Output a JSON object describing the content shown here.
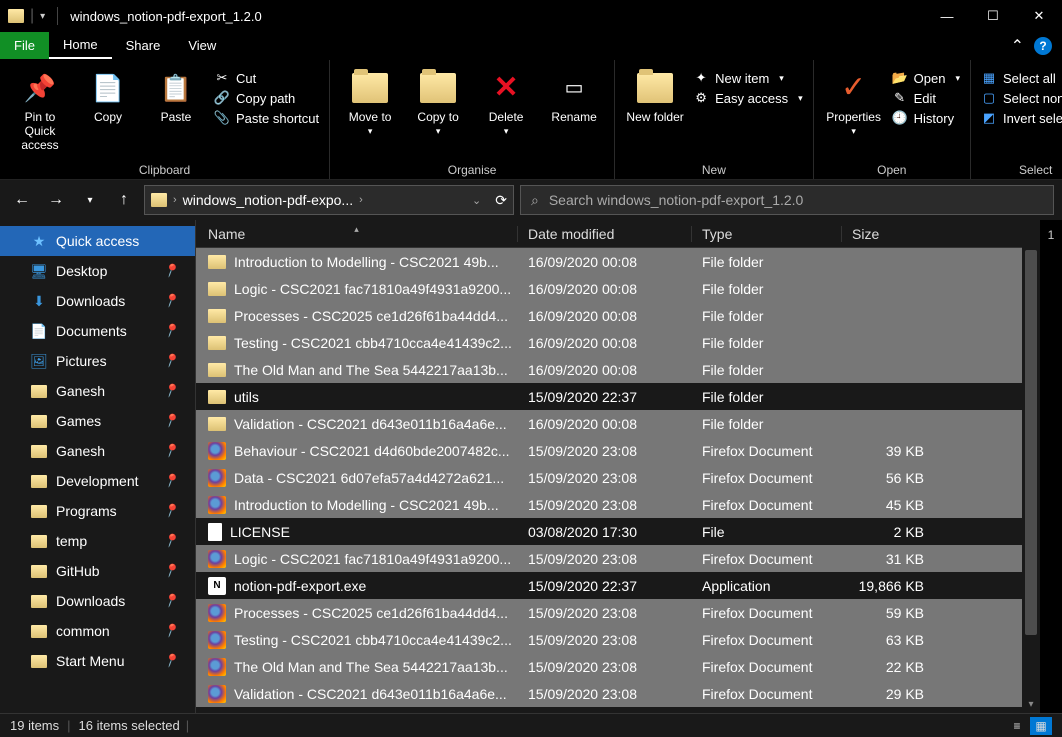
{
  "title": "windows_notion-pdf-export_1.2.0",
  "ribbon_tabs": {
    "file": "File",
    "home": "Home",
    "share": "Share",
    "view": "View"
  },
  "ribbon": {
    "pin": "Pin to Quick access",
    "copy": "Copy",
    "paste": "Paste",
    "cut": "Cut",
    "copy_path": "Copy path",
    "paste_shortcut": "Paste shortcut",
    "clipboard_label": "Clipboard",
    "move_to": "Move to",
    "copy_to": "Copy to",
    "delete": "Delete",
    "rename": "Rename",
    "organise_label": "Organise",
    "new_folder": "New folder",
    "new_item": "New item",
    "easy_access": "Easy access",
    "new_label": "New",
    "properties": "Properties",
    "open": "Open",
    "edit": "Edit",
    "history": "History",
    "open_label": "Open",
    "select_all": "Select all",
    "select_none": "Select none",
    "invert_selection": "Invert selection",
    "select_label": "Select"
  },
  "address": {
    "crumb": "windows_notion-pdf-expo..."
  },
  "search": {
    "placeholder": "Search windows_notion-pdf-export_1.2.0"
  },
  "sidebar": {
    "quick_access": "Quick access",
    "items": [
      {
        "label": "Desktop",
        "icon": "desktop"
      },
      {
        "label": "Downloads",
        "icon": "download"
      },
      {
        "label": "Documents",
        "icon": "doc"
      },
      {
        "label": "Pictures",
        "icon": "pic"
      },
      {
        "label": "Ganesh",
        "icon": "folder"
      },
      {
        "label": "Games",
        "icon": "folder"
      },
      {
        "label": "Ganesh",
        "icon": "folder"
      },
      {
        "label": "Development",
        "icon": "folder"
      },
      {
        "label": "Programs",
        "icon": "folder"
      },
      {
        "label": "temp",
        "icon": "folder"
      },
      {
        "label": "GitHub",
        "icon": "folder"
      },
      {
        "label": "Downloads",
        "icon": "folder"
      },
      {
        "label": "common",
        "icon": "folder"
      },
      {
        "label": "Start Menu",
        "icon": "folder"
      }
    ]
  },
  "columns": {
    "name": "Name",
    "date": "Date modified",
    "type": "Type",
    "size": "Size"
  },
  "files": [
    {
      "sel": true,
      "icon": "folder",
      "name": "Introduction to Modelling - CSC2021 49b...",
      "date": "16/09/2020 00:08",
      "type": "File folder",
      "size": ""
    },
    {
      "sel": true,
      "icon": "folder",
      "name": "Logic - CSC2021 fac71810a49f4931a9200...",
      "date": "16/09/2020 00:08",
      "type": "File folder",
      "size": ""
    },
    {
      "sel": true,
      "icon": "folder",
      "name": "Processes - CSC2025 ce1d26f61ba44dd4...",
      "date": "16/09/2020 00:08",
      "type": "File folder",
      "size": ""
    },
    {
      "sel": true,
      "icon": "folder",
      "name": "Testing - CSC2021 cbb4710cca4e41439c2...",
      "date": "16/09/2020 00:08",
      "type": "File folder",
      "size": ""
    },
    {
      "sel": true,
      "icon": "folder",
      "name": "The Old Man and The Sea 5442217aa13b...",
      "date": "16/09/2020 00:08",
      "type": "File folder",
      "size": ""
    },
    {
      "sel": false,
      "icon": "folder",
      "name": "utils",
      "date": "15/09/2020 22:37",
      "type": "File folder",
      "size": ""
    },
    {
      "sel": true,
      "icon": "folder",
      "name": "Validation - CSC2021 d643e011b16a4a6e...",
      "date": "16/09/2020 00:08",
      "type": "File folder",
      "size": ""
    },
    {
      "sel": true,
      "icon": "ff",
      "name": "Behaviour - CSC2021 d4d60bde2007482c...",
      "date": "15/09/2020 23:08",
      "type": "Firefox Document",
      "size": "39 KB"
    },
    {
      "sel": true,
      "icon": "ff",
      "name": "Data - CSC2021 6d07efa57a4d4272a621...",
      "date": "15/09/2020 23:08",
      "type": "Firefox Document",
      "size": "56 KB"
    },
    {
      "sel": true,
      "icon": "ff",
      "name": "Introduction to Modelling - CSC2021 49b...",
      "date": "15/09/2020 23:08",
      "type": "Firefox Document",
      "size": "45 KB"
    },
    {
      "sel": false,
      "icon": "file",
      "name": "LICENSE",
      "date": "03/08/2020 17:30",
      "type": "File",
      "size": "2 KB"
    },
    {
      "sel": true,
      "icon": "ff",
      "name": "Logic - CSC2021 fac71810a49f4931a9200...",
      "date": "15/09/2020 23:08",
      "type": "Firefox Document",
      "size": "31 KB"
    },
    {
      "sel": false,
      "icon": "exe",
      "name": "notion-pdf-export.exe",
      "date": "15/09/2020 22:37",
      "type": "Application",
      "size": "19,866 KB"
    },
    {
      "sel": true,
      "icon": "ff",
      "name": "Processes - CSC2025 ce1d26f61ba44dd4...",
      "date": "15/09/2020 23:08",
      "type": "Firefox Document",
      "size": "59 KB"
    },
    {
      "sel": true,
      "icon": "ff",
      "name": "Testing - CSC2021 cbb4710cca4e41439c2...",
      "date": "15/09/2020 23:08",
      "type": "Firefox Document",
      "size": "63 KB"
    },
    {
      "sel": true,
      "icon": "ff",
      "name": "The Old Man and The Sea 5442217aa13b...",
      "date": "15/09/2020 23:08",
      "type": "Firefox Document",
      "size": "22 KB"
    },
    {
      "sel": true,
      "icon": "ff",
      "name": "Validation - CSC2021 d643e011b16a4a6e...",
      "date": "15/09/2020 23:08",
      "type": "Firefox Document",
      "size": "29 KB"
    }
  ],
  "status": {
    "items": "19 items",
    "selected": "16 items selected"
  },
  "right_gutter": "1"
}
